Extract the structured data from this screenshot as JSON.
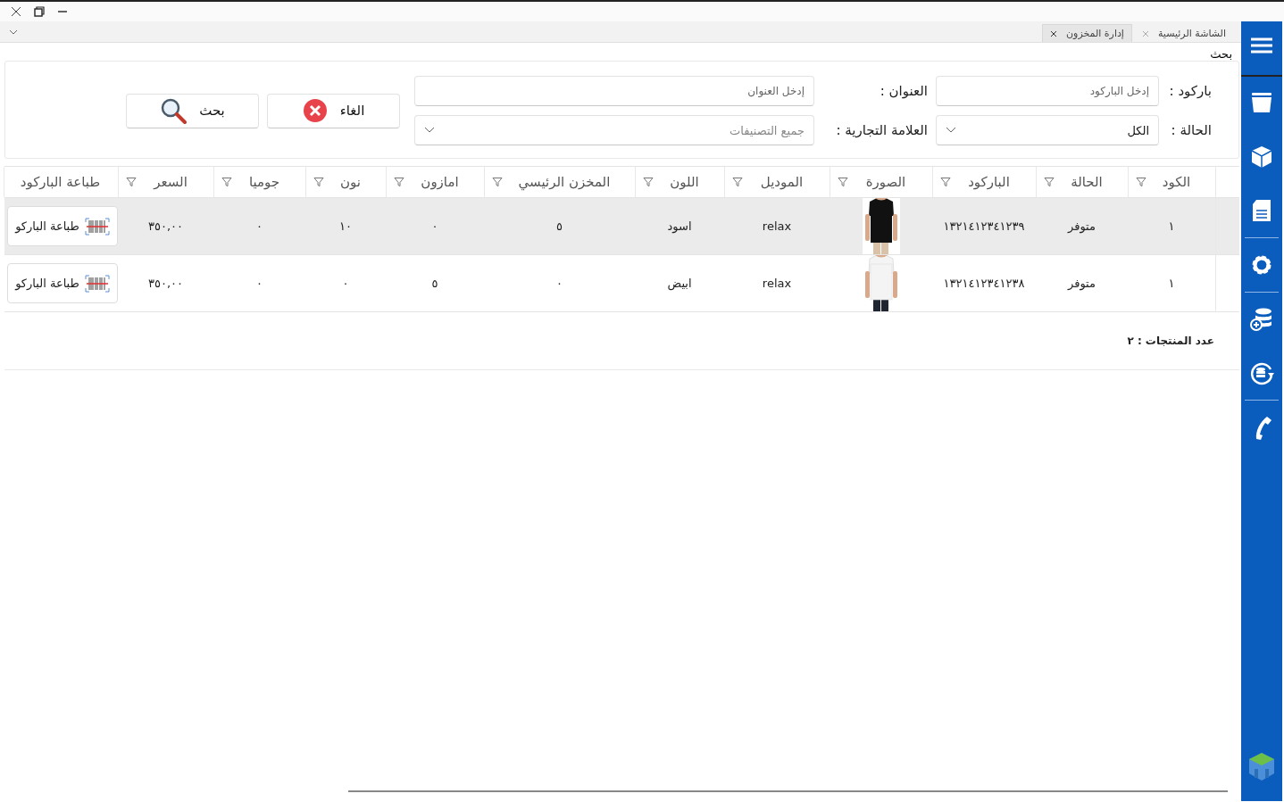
{
  "tabs": [
    {
      "label": "الشاشة الرئيسية",
      "selected": false
    },
    {
      "label": "إدارة المخزون",
      "selected": true
    }
  ],
  "search": {
    "legend": "بحث",
    "fields": [
      {
        "kind": "text",
        "label": "باركود :",
        "placeholder": "إدخل الباركود"
      },
      {
        "kind": "text",
        "label": "العنوان :",
        "placeholder": "إدخل العنوان"
      },
      {
        "kind": "select",
        "label": "الحالة :",
        "value": "الكل"
      },
      {
        "kind": "select",
        "label": "العلامة التجارية :",
        "placeholder": "جميع التصنيفات"
      }
    ],
    "buttons": [
      {
        "kind": "cancel",
        "label": "الغاء"
      },
      {
        "kind": "search",
        "label": "بحث"
      }
    ]
  },
  "table": {
    "columns": [
      {
        "label": "الكود",
        "filter": true
      },
      {
        "label": "الحالة",
        "filter": true
      },
      {
        "label": "الباركود",
        "filter": true
      },
      {
        "label": "الصورة",
        "filter": true
      },
      {
        "label": "الموديل",
        "filter": true
      },
      {
        "label": "اللون",
        "filter": true
      },
      {
        "label": "المخزن الرئيسي",
        "filter": true
      },
      {
        "label": "امازون",
        "filter": true
      },
      {
        "label": "نون",
        "filter": true
      },
      {
        "label": "جوميا",
        "filter": true
      },
      {
        "label": "السعر",
        "filter": true
      },
      {
        "label": "طباعة الباركود",
        "filter": false
      }
    ],
    "rows": [
      {
        "selected": true,
        "code": "١",
        "status": "متوفر",
        "barcode": "١٣٢١٤١٢٣٤١٢٣٩",
        "model": "relax",
        "shade": "اسود",
        "main_store": "٥",
        "amazon": "٠",
        "noon": "١٠",
        "jumia": "٠",
        "price": "٣٥٠,٠٠",
        "print": "طباعة الباركو"
      },
      {
        "selected": false,
        "code": "١",
        "status": "متوفر",
        "barcode": "١٣٢١٤١٢٣٤١٢٣٨",
        "model": "relax",
        "shade": "ابيض",
        "main_store": "٠",
        "amazon": "٥",
        "noon": "٠",
        "jumia": "٠",
        "price": "٣٥٠,٠٠",
        "print": "طباعة الباركو"
      }
    ]
  },
  "footer": {
    "count": "عدد المنتجات : ٢"
  }
}
